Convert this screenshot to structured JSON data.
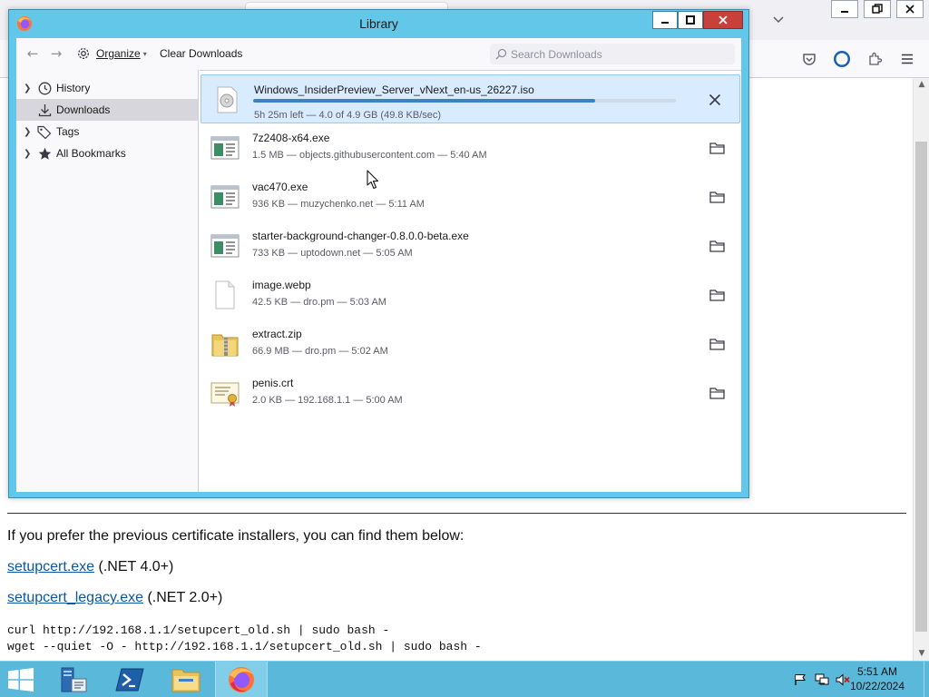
{
  "browser": {
    "list_all_tabs_icon": "chevron-down-icon",
    "window_controls": [
      "minimize",
      "restore",
      "close"
    ],
    "toolbar_icons": [
      "pocket-icon",
      "account-icon",
      "extensions-icon",
      "menu-icon"
    ]
  },
  "page": {
    "text_line": "If you prefer the previous certificate installers, you can find them below:",
    "links": [
      {
        "label": "setupcert.exe",
        "suffix": " (.NET 4.0+)"
      },
      {
        "label": "setupcert_legacy.exe",
        "suffix": " (.NET 2.0+)"
      }
    ],
    "code_lines": [
      "curl http://192.168.1.1/setupcert_old.sh | sudo bash -",
      "wget --quiet -O - http://192.168.1.1/setupcert_old.sh | sudo bash -"
    ]
  },
  "library": {
    "title": "Library",
    "toolbar": {
      "organize_label": "Organize",
      "clear_label": "Clear Downloads",
      "search_placeholder": "Search Downloads"
    },
    "sidebar": [
      {
        "label": "History",
        "icon": "clock-icon",
        "expandable": true,
        "selected": false
      },
      {
        "label": "Downloads",
        "icon": "download-icon",
        "expandable": false,
        "selected": true
      },
      {
        "label": "Tags",
        "icon": "tag-icon",
        "expandable": true,
        "selected": false
      },
      {
        "label": "All Bookmarks",
        "icon": "star-icon",
        "expandable": true,
        "selected": false
      }
    ],
    "downloads": [
      {
        "name": "Windows_InsiderPreview_Server_vNext_en-us_26227.iso",
        "status": "5h 25m left — 4.0 of 4.9 GB (49.8 KB/sec)",
        "progress": 0.81,
        "icon": "disc-image-icon",
        "action": "cancel",
        "active": true
      },
      {
        "name": "7z2408-x64.exe",
        "status": "1.5 MB — objects.githubusercontent.com — 5:40 AM",
        "icon": "executable-icon",
        "action": "open-folder",
        "active": false
      },
      {
        "name": "vac470.exe",
        "status": "936 KB — muzychenko.net — 5:11 AM",
        "icon": "executable-icon",
        "action": "open-folder",
        "active": false
      },
      {
        "name": "starter-background-changer-0.8.0.0-beta.exe",
        "status": "733 KB — uptodown.net — 5:05 AM",
        "icon": "executable-icon",
        "action": "open-folder",
        "active": false
      },
      {
        "name": "image.webp",
        "status": "42.5 KB — dro.pm — 5:03 AM",
        "icon": "blank-file-icon",
        "action": "open-folder",
        "active": false
      },
      {
        "name": "extract.zip",
        "status": "66.9 MB — dro.pm — 5:02 AM",
        "icon": "zip-folder-icon",
        "action": "open-folder",
        "active": false
      },
      {
        "name": "penis.crt",
        "status": "2.0 KB — 192.168.1.1 — 5:00 AM",
        "icon": "certificate-icon",
        "action": "open-folder",
        "active": false
      }
    ]
  },
  "taskbar": {
    "apps": [
      "server-manager-icon",
      "powershell-icon",
      "file-explorer-icon",
      "firefox-icon"
    ],
    "active_app": "firefox-icon",
    "tray": [
      "flag-icon",
      "network-icon",
      "volume-muted-icon"
    ],
    "time": "5:51 AM",
    "date": "10/22/2024"
  }
}
